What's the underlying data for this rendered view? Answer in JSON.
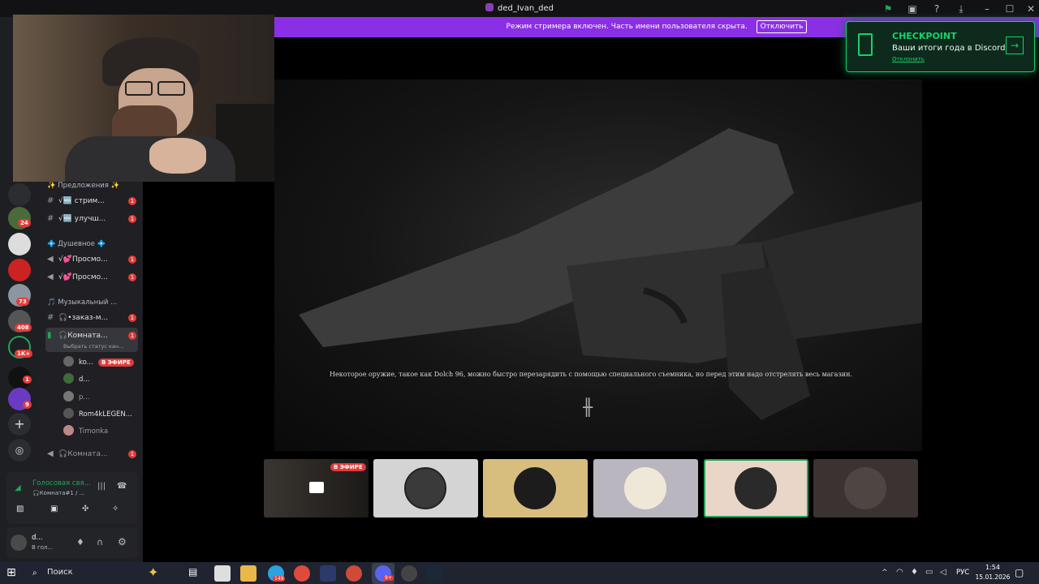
{
  "window": {
    "title": "ded_Ivan_ded"
  },
  "banner": {
    "text": "Режим стримера включен. Часть имени пользователя скрыта.",
    "button": "Отключить"
  },
  "rail_badges": [
    "24",
    "73",
    "408",
    "1K+",
    "1",
    "9"
  ],
  "channels": {
    "cat1": "✨ Предложения ✨",
    "ch1": "√🆕 стрим...",
    "ch2": "√🆕 улучш...",
    "cat2": "💠 Душевное 💠",
    "ch3": "√💕Просмо...",
    "ch4": "√💕Просмо...",
    "cat3": "🎵 Музыкальный ...",
    "ch5": "🎧•заказ-м...",
    "ch6": "🎧Комната...",
    "ch6_status": "Выбрать статус кан...",
    "ch7": "🎧Комната...",
    "unread": "1"
  },
  "voice_members": [
    {
      "name": "ko...",
      "live": "В ЭФИРЕ"
    },
    {
      "name": "d..."
    },
    {
      "name": "p..."
    },
    {
      "name": "Rom4kLEGEN..."
    },
    {
      "name": "Timonka"
    }
  ],
  "voice_panel": {
    "status": "Голосовая свя...",
    "channel": "🎧Комната#1 / ..."
  },
  "user_panel": {
    "name": "d...",
    "status": "В гол..."
  },
  "checkpoint": {
    "title": "CHECKPOINT",
    "subtitle": "Ваши итоги года в Discord",
    "dismiss": "Отклонить"
  },
  "stage": {
    "caption": "Некоторое оружие, такое как Dolch 96, можно быстро перезарядить с помощью специального съемника, но перед этим надо отстрелять весь магазин."
  },
  "tiles": {
    "live_label": "В ЭФИРЕ"
  },
  "taskbar": {
    "search": "Поиск",
    "lang": "РУС",
    "time": "1:54",
    "date": "15.01.2026",
    "steam_badge": "149",
    "discord_badge": "9+"
  },
  "colors": {
    "accent_purple": "#8b2fe6",
    "discord_green": "#23a559",
    "live_red": "#e23b3b",
    "checkpoint_green": "#18d16b"
  },
  "icons": [
    "window-minimize-icon",
    "window-maximize-icon",
    "window-close-icon",
    "help-icon",
    "download-icon",
    "inbox-icon",
    "flag-icon",
    "gun-cursor-icon"
  ]
}
